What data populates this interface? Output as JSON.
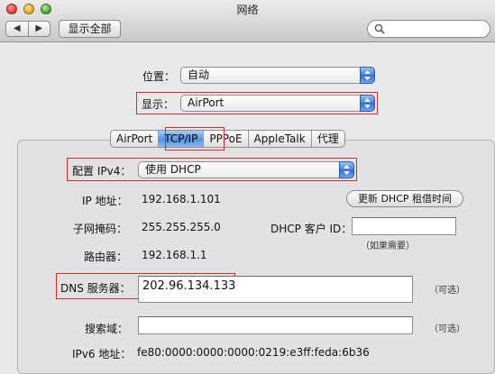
{
  "window": {
    "title": "网络"
  },
  "toolbar": {
    "back_glyph": "◀",
    "forward_glyph": "▶",
    "show_all_label": "显示全部",
    "search_value": ""
  },
  "location": {
    "label": "位置：",
    "value": "自动"
  },
  "show": {
    "label": "显示：",
    "value": "AirPort"
  },
  "tabs": [
    {
      "label": "AirPort"
    },
    {
      "label": "TCP/IP",
      "active": true
    },
    {
      "label": "PPPoE"
    },
    {
      "label": "AppleTalk"
    },
    {
      "label": "代理"
    }
  ],
  "tcpip": {
    "configure_label": "配置 IPv4：",
    "configure_value": "使用 DHCP",
    "ip_label": "IP 地址：",
    "ip_value": "192.168.1.101",
    "renew_button": "更新 DHCP 租借时间",
    "subnet_label": "子网掩码：",
    "subnet_value": "255.255.255.0",
    "dhcp_client_id_label": "DHCP 客户 ID：",
    "dhcp_client_id_value": "",
    "dhcp_client_id_hint": "（如果需要）",
    "router_label": "路由器：",
    "router_value": "192.168.1.1",
    "dns_label": "DNS 服务器：",
    "dns_value": "202.96.134.133",
    "dns_hint": "（可选）",
    "search_domains_label": "搜索域：",
    "search_domains_value": "",
    "search_domains_hint": "（可选）",
    "ipv6_label": "IPv6 地址：",
    "ipv6_value": "fe80:0000:0000:0000:0219:e3ff:feda:6b36"
  },
  "colors": {
    "highlight": "#d22b2b",
    "accent": "#3b7de0"
  }
}
